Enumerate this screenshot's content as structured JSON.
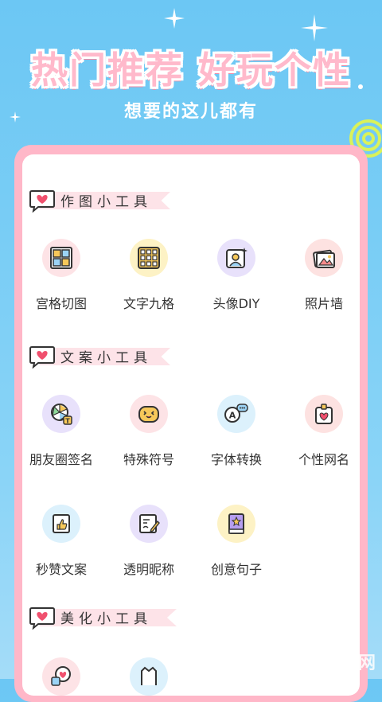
{
  "hero": {
    "title": "热门推荐  好玩个性",
    "subtitle": "想要的这儿都有"
  },
  "sections": [
    {
      "title": "作图小工具",
      "tools": [
        {
          "label": "宫格切图",
          "icon": "grid-cut-icon"
        },
        {
          "label": "文字九格",
          "icon": "nine-grid-icon"
        },
        {
          "label": "头像DIY",
          "icon": "avatar-diy-icon"
        },
        {
          "label": "照片墙",
          "icon": "photo-wall-icon"
        }
      ]
    },
    {
      "title": "文案小工具",
      "tools": [
        {
          "label": "朋友圈签名",
          "icon": "moments-signature-icon"
        },
        {
          "label": "特殊符号",
          "icon": "emoji-symbol-icon"
        },
        {
          "label": "字体转换",
          "icon": "font-convert-icon"
        },
        {
          "label": "个性网名",
          "icon": "nickname-icon"
        },
        {
          "label": "秒赞文案",
          "icon": "thumbs-up-icon"
        },
        {
          "label": "透明昵称",
          "icon": "transparent-name-icon"
        },
        {
          "label": "创意句子",
          "icon": "creative-book-icon"
        }
      ]
    },
    {
      "title": "美化小工具",
      "tools": [
        {
          "label": "",
          "icon": "beautify-heart-icon"
        },
        {
          "label": "",
          "icon": "beautify-frame-icon"
        }
      ]
    }
  ],
  "watermark": "818手游网",
  "colors": {
    "background": "#79cdf5",
    "card_frame": "#ffb7c8",
    "title_pink": "#ffb9cb",
    "ribbon": "#fde3e8",
    "heart": "#f0506e"
  }
}
